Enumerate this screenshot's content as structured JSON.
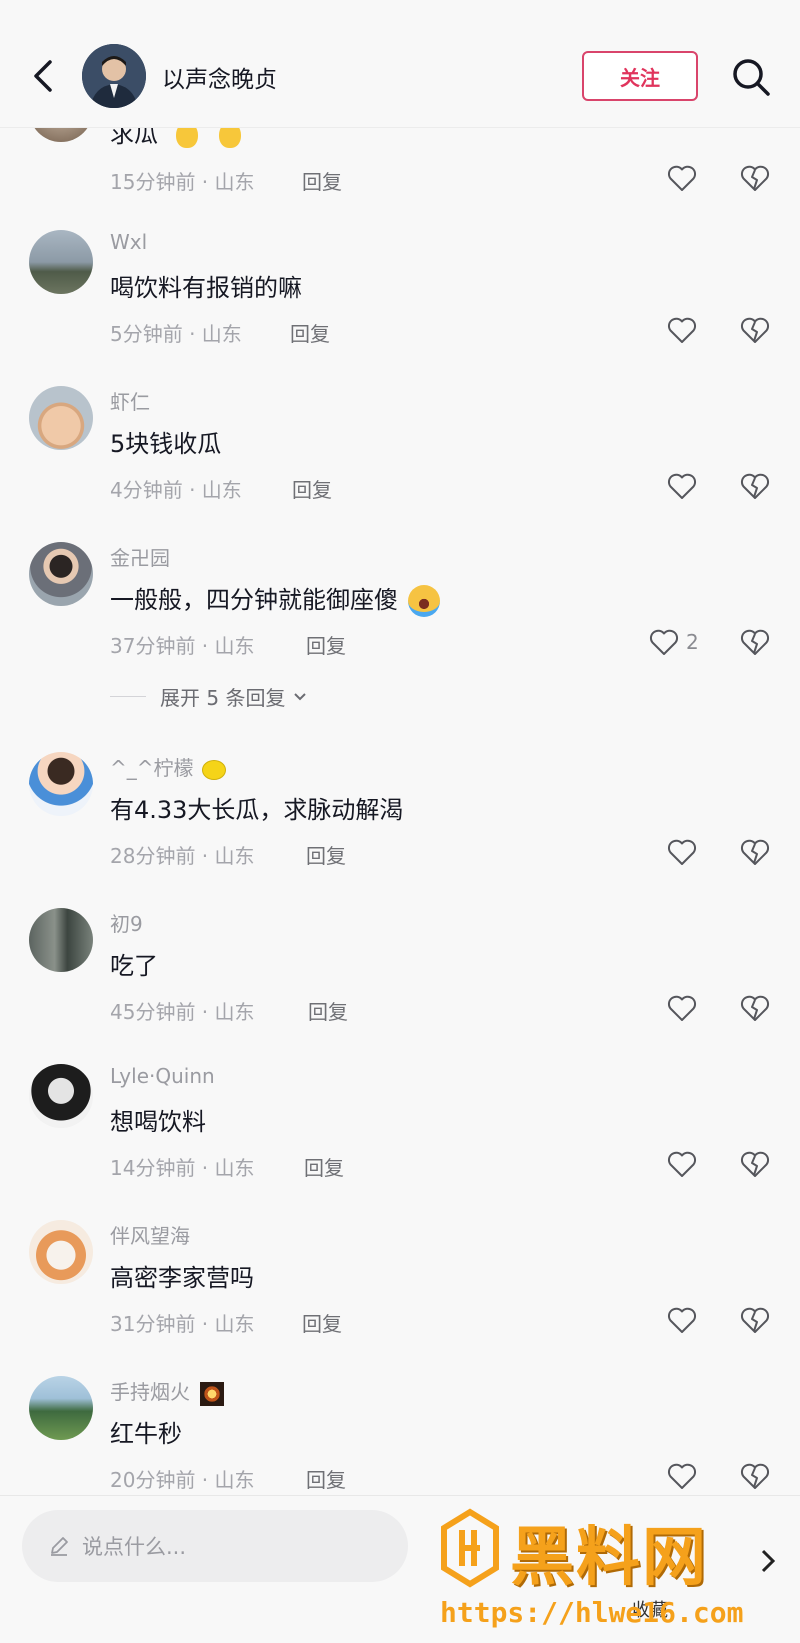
{
  "header": {
    "username": "以声念晚贞",
    "follow_label": "关注",
    "back_icon": "back-arrow-icon",
    "search_icon": "search-icon"
  },
  "comments": [
    {
      "username": "",
      "text": "求瓜",
      "emoji": "pear-emoji",
      "time_location": "15分钟前 · 山东",
      "reply": "回复",
      "likes": ""
    },
    {
      "username": "Wxl",
      "text": "喝饮料有报销的嘛",
      "time_location": "5分钟前 · 山东",
      "reply": "回复",
      "likes": ""
    },
    {
      "username": "虾仁",
      "text": "5块钱收瓜",
      "time_location": "4分钟前 · 山东",
      "reply": "回复",
      "likes": ""
    },
    {
      "username": "金卍园",
      "text": "一般般，四分钟就能御座傻",
      "emoji": "crying-laughing-emoji",
      "time_location": "37分钟前 · 山东",
      "reply": "回复",
      "likes": "2"
    },
    {
      "username": "^_^柠檬",
      "text": "有4.33大长瓜，求脉动解渴",
      "time_location": "28分钟前 · 山东",
      "reply": "回复",
      "likes": ""
    },
    {
      "username": "初9",
      "text": "吃了",
      "time_location": "45分钟前 · 山东",
      "reply": "回复",
      "likes": ""
    },
    {
      "username": "Lyle·Quinn",
      "text": "想喝饮料",
      "time_location": "14分钟前 · 山东",
      "reply": "回复",
      "likes": ""
    },
    {
      "username": "伴风望海",
      "text": "高密李家营吗",
      "time_location": "31分钟前 · 山东",
      "reply": "回复",
      "likes": ""
    },
    {
      "username": "手持烟火",
      "text": "红牛秒",
      "time_location": "20分钟前 · 山东",
      "reply": "回复",
      "likes": ""
    }
  ],
  "expand_replies": "展开 5 条回复",
  "bottom": {
    "input_placeholder": "说点什么...",
    "partial_label": "收藏"
  },
  "watermark": {
    "title": "黑料网",
    "url": "https://hlwe16.com"
  },
  "colors": {
    "accent": "#e0345c",
    "watermark": "#f5a11b"
  }
}
